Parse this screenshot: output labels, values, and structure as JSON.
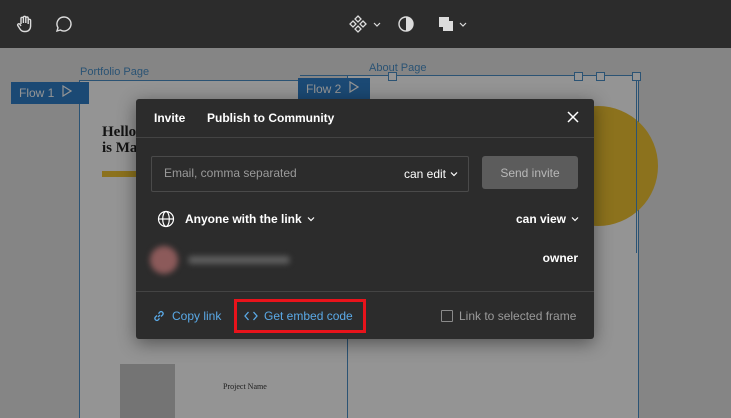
{
  "toolbar": {
    "icons": [
      "hand-icon",
      "comment-icon",
      "component-icon",
      "contrast-icon",
      "boolean-icon"
    ]
  },
  "canvas": {
    "frames": [
      {
        "label": "Portfolio Page"
      },
      {
        "label": "About Page"
      }
    ],
    "flows": [
      {
        "label": "Flow 1"
      },
      {
        "label": "Flow 2"
      }
    ],
    "project_name": "Project Name",
    "hero_text_line1": "Hello,",
    "hero_text_line2": "is Mad"
  },
  "modal": {
    "tabs": [
      {
        "label": "Invite"
      },
      {
        "label": "Publish to Community"
      }
    ],
    "email": {
      "placeholder": "Email, comma separated",
      "value": ""
    },
    "email_permission": "can edit",
    "send_button": "Send invite",
    "link_access": "Anyone with the link",
    "link_permission": "can view",
    "owner_role": "owner",
    "footer": {
      "copy_link": "Copy link",
      "embed_code": "Get embed code",
      "link_selected": "Link to selected frame"
    }
  },
  "colors": {
    "accent": "#5aa9e6",
    "highlight": "#e8131b",
    "modal_bg": "#2c2c2c",
    "flow_blue": "#2f7fc9"
  }
}
